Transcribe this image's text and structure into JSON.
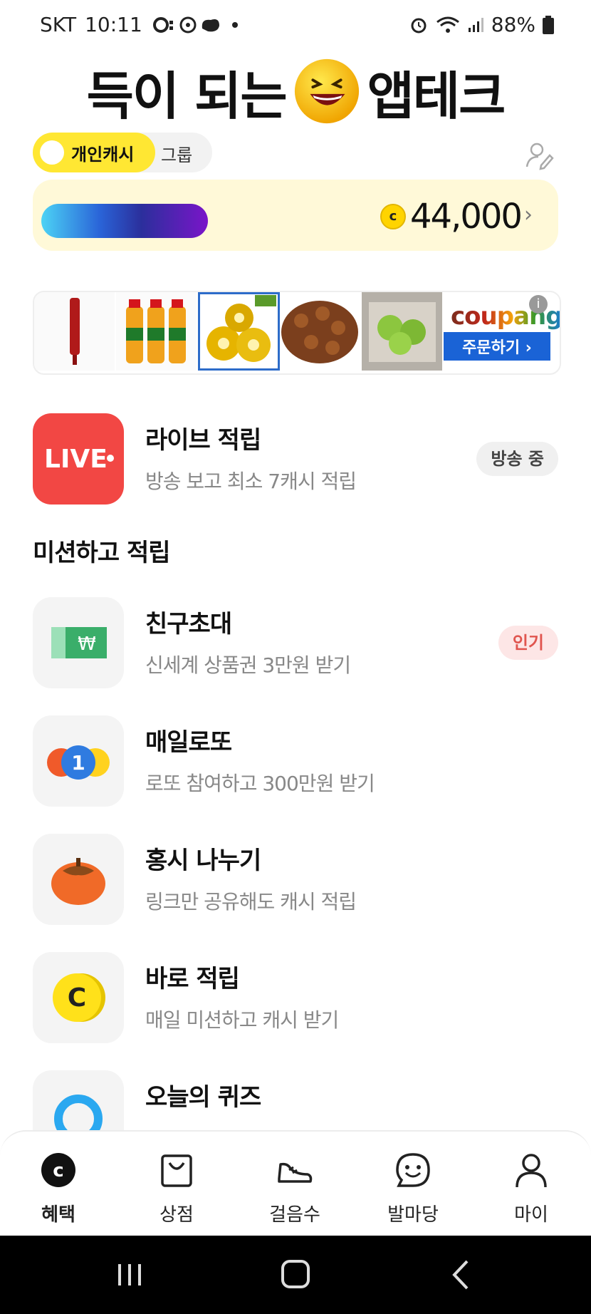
{
  "status_bar": {
    "carrier": "SKT",
    "time": "10:11",
    "battery": "88%"
  },
  "banner": {
    "text_left": "득이 되는",
    "text_right": "앱테크"
  },
  "toggle": {
    "personal": "개인캐시",
    "group": "그룹"
  },
  "cash": {
    "coin_symbol": "c",
    "amount": "44,000"
  },
  "ad": {
    "brand": "coupang",
    "order_button": "주문하기 ›",
    "info_symbol": "i"
  },
  "live": {
    "icon_text": "LIVE",
    "title": "라이브 적립",
    "desc": "방송 보고 최소 7캐시 적립",
    "badge": "방송 중"
  },
  "section": {
    "missions_title": "미션하고 적립"
  },
  "missions": [
    {
      "title": "친구초대",
      "desc": "신세계 상품권 3만원 받기",
      "badge": "인기",
      "icon": "voucher-icon"
    },
    {
      "title": "매일로또",
      "desc": "로또 참여하고 300만원 받기",
      "icon": "lotto-icon"
    },
    {
      "title": "홍시 나누기",
      "desc": "링크만 공유해도 캐시 적립",
      "icon": "persimmon-icon"
    },
    {
      "title": "바로 적립",
      "desc": "매일 미션하고 캐시 받기",
      "icon": "coin-icon"
    },
    {
      "title": "오늘의 퀴즈",
      "desc": "",
      "icon": "quiz-icon"
    }
  ],
  "nav": {
    "items": [
      {
        "label": "혜택",
        "icon": "benefit-coin-icon"
      },
      {
        "label": "상점",
        "icon": "shopping-bag-icon"
      },
      {
        "label": "걸음수",
        "icon": "sneaker-icon"
      },
      {
        "label": "발마당",
        "icon": "chat-smile-icon"
      },
      {
        "label": "마이",
        "icon": "person-icon"
      }
    ]
  },
  "colors": {
    "yellow": "#ffe733",
    "cash_bg": "#fff9d8",
    "live_red": "#f24744",
    "coupang_blue": "#1a63d6",
    "hot_pink_text": "#e0554f"
  }
}
